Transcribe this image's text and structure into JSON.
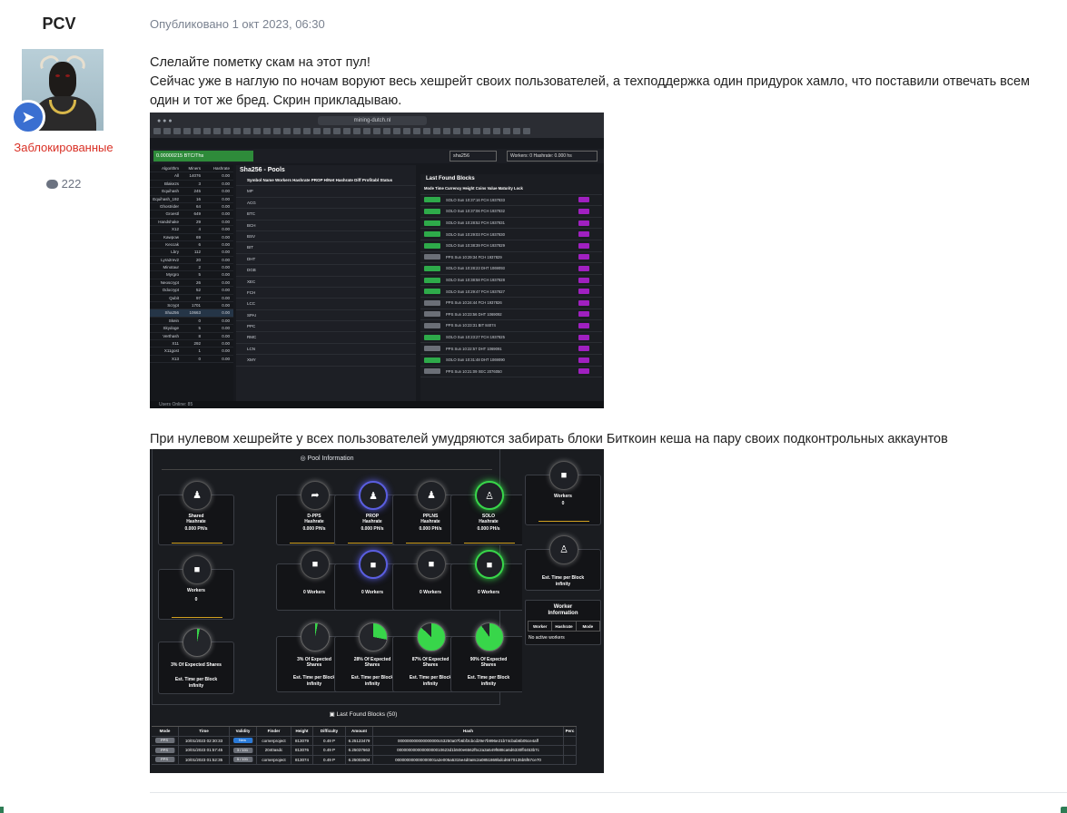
{
  "author": {
    "name": "PCV",
    "group": "Заблокированные",
    "post_count": "222"
  },
  "post": {
    "meta": "Опубликовано 1 окт 2023, 06:30",
    "line1": "Слелайте пометку скам на этот пул!",
    "line2": "Сейчас уже в наглую по ночам воруют весь хешрейт своих пользователей, а техподдержка один придурок хамло, что поставили отвечать всем один и тот же бред. Скрин прикладываю.",
    "line3": "При нулевом хешрейте у всех пользователей умудряются забирать блоки Биткоин кеша на пару своих подконтрольных аккаунтов"
  },
  "shot1": {
    "url": "mining-dutch.nl",
    "balance": "0.00000215 BTC/Ths",
    "algo_select": "sha256",
    "workers": "Workers: 0   Hashrate: 0.000 hs",
    "side_header": [
      "Algorithm",
      "Miners",
      "Hashrate"
    ],
    "side_rows": [
      [
        "All",
        "14076",
        "0.00"
      ],
      [
        "Blake2s",
        "3",
        "0.00"
      ],
      [
        "Equihash",
        "245",
        "0.00"
      ],
      [
        "Equihash_192",
        "16",
        "0.00"
      ],
      [
        "Ghostrider",
        "64",
        "0.00"
      ],
      [
        "Groestl",
        "649",
        "0.00"
      ],
      [
        "Handshake",
        "29",
        "0.00"
      ],
      [
        "X12",
        "4",
        "0.00"
      ],
      [
        "Kawpow",
        "69",
        "0.00"
      ],
      [
        "Keccak",
        "6",
        "0.00"
      ],
      [
        "Lbry",
        "112",
        "0.00"
      ],
      [
        "Lyra2rev2",
        "20",
        "0.00"
      ],
      [
        "Minotaur",
        "2",
        "0.00"
      ],
      [
        "Myrgro",
        "5",
        "0.00"
      ],
      [
        "Neoscrypt",
        "26",
        "0.00"
      ],
      [
        "Odocrypt",
        "52",
        "0.00"
      ],
      [
        "Qubit",
        "97",
        "0.00"
      ],
      [
        "Scrypt",
        "1701",
        "0.00"
      ],
      [
        "Sha256",
        "10663",
        "0.00"
      ],
      [
        "Skein",
        "0",
        "0.00"
      ],
      [
        "Skydoge",
        "5",
        "0.00"
      ],
      [
        "Verthash",
        "8",
        "0.00"
      ],
      [
        "X11",
        "292",
        "0.00"
      ],
      [
        "X11gost",
        "1",
        "0.00"
      ],
      [
        "X13",
        "0",
        "0.00"
      ]
    ],
    "pools_title": "Sha256 - Pools",
    "pools_header": "Symbol  Name  Workers Hashrate PROP H/Net Hashrate  Diff  Profitabl  Status",
    "pools": [
      "MP",
      "ACG",
      "BTC",
      "BCH",
      "BSV",
      "BIT",
      "DHT",
      "DGB",
      "XEC",
      "FCH",
      "LCC",
      "SPAI",
      "PPC",
      "RMC",
      "LCN",
      "XMY"
    ],
    "blocks_title": "Last Found Blocks",
    "blocks_header": "Mode   Time   Currency   Height   Coins  Value  Maturity  Lock",
    "blocks": [
      [
        "SOLO",
        "Sun 10:37:16",
        "FCH",
        "1937833"
      ],
      [
        "SOLO",
        "Sun 10:37:06",
        "FCH",
        "1937832"
      ],
      [
        "SOLO",
        "Sun 10:28:52",
        "FCH",
        "1937831"
      ],
      [
        "SOLO",
        "Sun 10:29:03",
        "FCH",
        "1937830"
      ],
      [
        "SOLO",
        "Sun 10:38:39",
        "FCH",
        "1937829"
      ],
      [
        "PPS",
        "Sun 10:29:34",
        "FCH",
        "1937829"
      ],
      [
        "SOLO",
        "Sun 10:28:23",
        "DHT",
        "1069093"
      ],
      [
        "SOLO",
        "Sun 10:38:58",
        "FCH",
        "1937828"
      ],
      [
        "SOLO",
        "Sun 10:29:47",
        "FCH",
        "1937827"
      ],
      [
        "PPS",
        "Sun 10:24:44",
        "FCH",
        "1937826"
      ],
      [
        "PPS",
        "Sun 10:23:56",
        "DHT",
        "1069092"
      ],
      [
        "PPS",
        "Sun 10:23:31",
        "BIT",
        "84074"
      ],
      [
        "SOLO",
        "Sun 10:23:27",
        "FCH",
        "1937825"
      ],
      [
        "PPS",
        "Sun 10:22:57",
        "DHT",
        "1069091"
      ],
      [
        "SOLO",
        "Sun 10:31:48",
        "DHT",
        "1069090"
      ],
      [
        "PPS",
        "Sun 10:21:09",
        "XEC",
        "2076050"
      ]
    ],
    "footer": "Users Online: 85"
  },
  "shot2": {
    "pool_info_title": "Pool Information",
    "cards_row1": [
      {
        "label": "Shared\nHashrate",
        "value": "0.000 PH/s"
      },
      {
        "label": "D-PPS\nHashrate",
        "value": "0.000 PH/s"
      },
      {
        "label": "PROP\nHashrate",
        "value": "0.000 PH/s"
      },
      {
        "label": "PPLNS\nHashrate",
        "value": "0.000 PH/s"
      },
      {
        "label": "SOLO\nHashrate",
        "value": "0.000 PH/s"
      }
    ],
    "workers_left": "Workers",
    "workers_left_value": "0",
    "workers_cards": [
      "0 Workers",
      "0 Workers",
      "0 Workers",
      "0 Workers"
    ],
    "shares_left": "3% Of Expected Shares",
    "shares": [
      {
        "label": "3% Of Expected\nShares",
        "fraction": 0.03
      },
      {
        "label": "28% Of Expected\nShares",
        "fraction": 0.28
      },
      {
        "label": "87% Of Expected\nShares",
        "fraction": 0.87
      },
      {
        "label": "90% Of Expected\nShares",
        "fraction": 0.9
      }
    ],
    "est_time": "Est. Time per Block",
    "infinity": "infinity",
    "side_workers": "Workers",
    "side_workers_value": "0",
    "side_est": "Est. Time per Block",
    "side_infinity": "infinity",
    "worker_info_title": "Worker\nInformation",
    "worker_info_cols": [
      "Worker",
      "Hashrate",
      "Mode"
    ],
    "no_workers": "No active workers",
    "last_blocks_title": "Last Found Blocks (50)",
    "table_header": [
      "Mode",
      "Time",
      "Validity",
      "Finder",
      "Height",
      "Difficulty",
      "Amount",
      "Hash",
      "Perc"
    ],
    "table_rows": [
      [
        "PPS",
        "10/01/2023 02:30:33",
        "New",
        "cornerproject",
        "813079",
        "0.49 P",
        "6.25123479",
        "000000000000000000c63250a07b6bf3cbcd29e7b996e21b74cbab6b05ce4aff"
      ],
      [
        "PPS",
        "10/01/2023 01:57:45",
        "3 / 101",
        "2040asdc",
        "813076",
        "0.49 P",
        "6.25037663",
        "00000000000000000010623d1b500e6562f5c2a3a549f688ca6d6330ff4453b7c"
      ],
      [
        "PPS",
        "10/01/2023 01:52:35",
        "5 / 101",
        "cornerproject",
        "813074",
        "0.49 P",
        "6.25002604",
        "000000000000000001a2e005a5315e4d0a8c2a0851869bdcd6670135b5f67ce70"
      ]
    ]
  },
  "colors": {
    "group": "#d93025",
    "meta": "#7a8290",
    "accent_green": "#38d64a",
    "accent_blue": "#5a5ee0"
  }
}
